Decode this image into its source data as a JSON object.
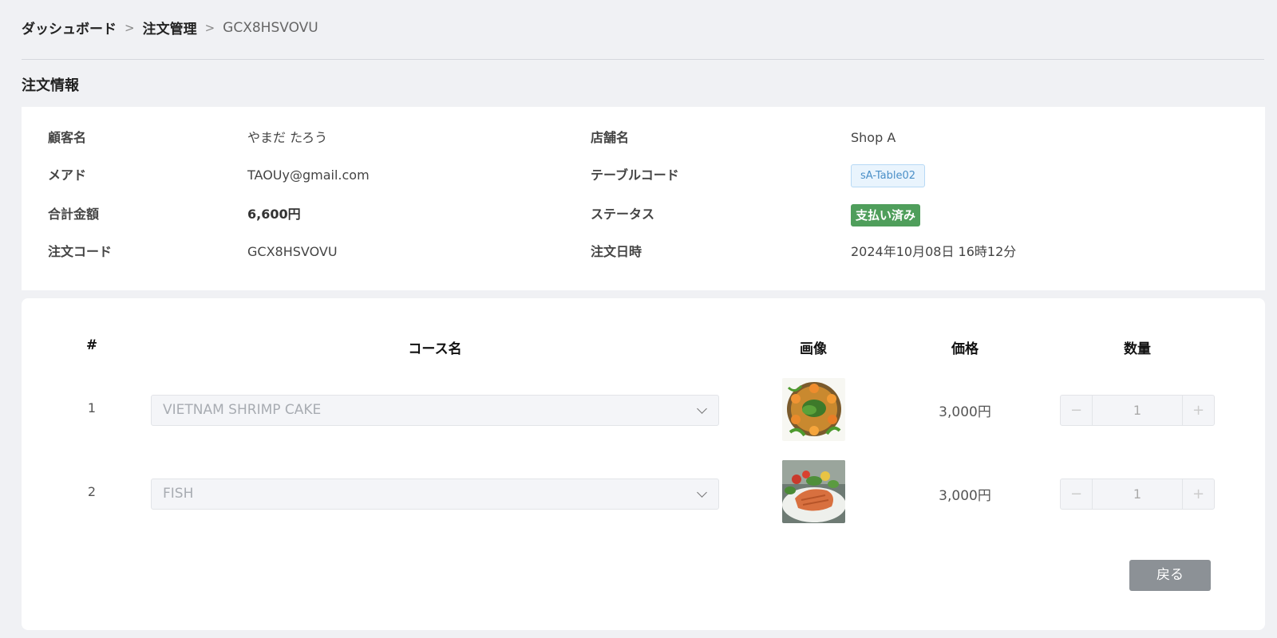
{
  "breadcrumb": {
    "items": [
      "ダッシュボード",
      "注文管理"
    ],
    "current": "GCX8HSVOVU",
    "separator": ">"
  },
  "section_title": "注文情報",
  "info": {
    "customer_name_label": "顧客名",
    "customer_name": "やまだ たろう",
    "email_label": "メアド",
    "email": "TAOUy@gmail.com",
    "total_label": "合計金額",
    "total": "6,600円",
    "order_code_label": "注文コード",
    "order_code": "GCX8HSVOVU",
    "shop_label": "店舗名",
    "shop": "Shop A",
    "table_code_label": "テーブルコード",
    "table_code": "sA-Table02",
    "status_label": "ステータス",
    "status": "支払い済み",
    "order_date_label": "注文日時",
    "order_date": "2024年10月08日 16時12分"
  },
  "table": {
    "headers": [
      "#",
      "コース名",
      "画像",
      "価格",
      "数量"
    ],
    "rows": [
      {
        "num": "1",
        "course": "VIETNAM SHRIMP CAKE",
        "image": "shrimp-cake-icon",
        "price": "3,000円",
        "qty": "1"
      },
      {
        "num": "2",
        "course": "FISH",
        "image": "salmon-dish-icon",
        "price": "3,000円",
        "qty": "1"
      }
    ],
    "minus": "−",
    "plus": "+"
  },
  "back_button": "戻る",
  "colors": {
    "status_badge": "#4f9e5b",
    "table_code_bg": "#e9f4fd",
    "back_button": "#8c9196"
  }
}
